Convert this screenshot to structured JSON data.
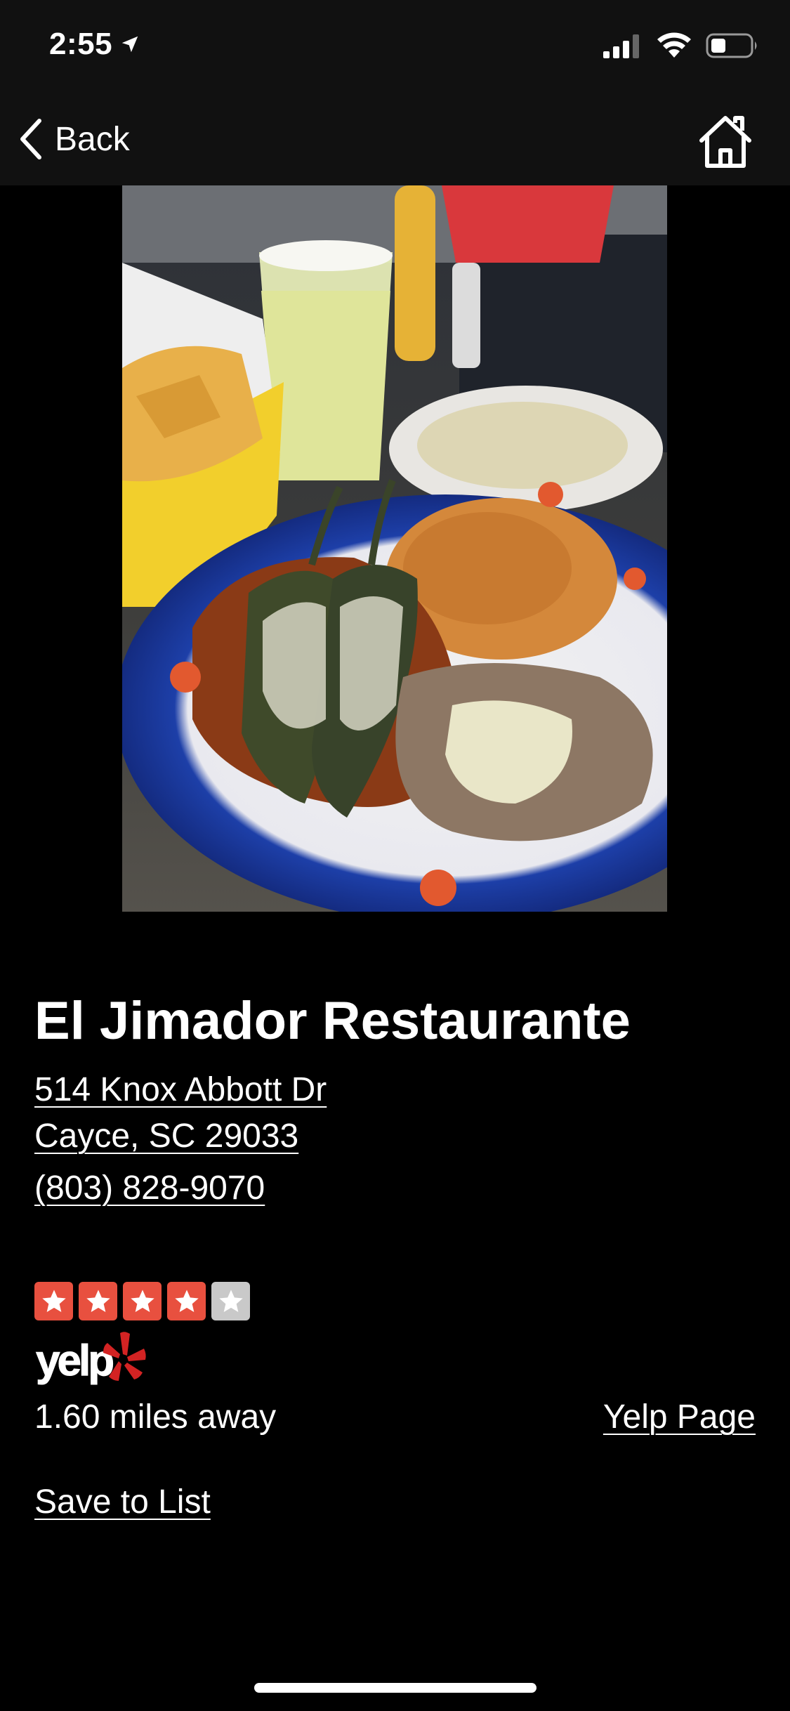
{
  "status_bar": {
    "time": "2:55",
    "icons": [
      "location-arrow-icon",
      "signal-icon",
      "wifi-icon",
      "battery-icon"
    ]
  },
  "nav": {
    "back_label": "Back",
    "back_icon": "chevron-left-icon",
    "home_icon": "home-icon"
  },
  "photo": {
    "subject": "Chile rellenos with rice, refried beans, chips, margarita and queso"
  },
  "restaurant": {
    "name": "El Jimador Restaurante",
    "address_line1": "514 Knox Abbott Dr",
    "address_line2": "Cayce, SC 29033",
    "phone": "(803) 828-9070",
    "rating": 4,
    "rating_max": 5,
    "rating_color": "#e8503f",
    "rating_empty_color": "#c9c9c9",
    "distance": "1.60 miles away",
    "yelp_link": "Yelp Page",
    "save_link": "Save to List",
    "yelp_logo_text": "yelp"
  },
  "colors": {
    "background": "#000000",
    "bar": "#111111",
    "yelp_red": "#d32323"
  }
}
